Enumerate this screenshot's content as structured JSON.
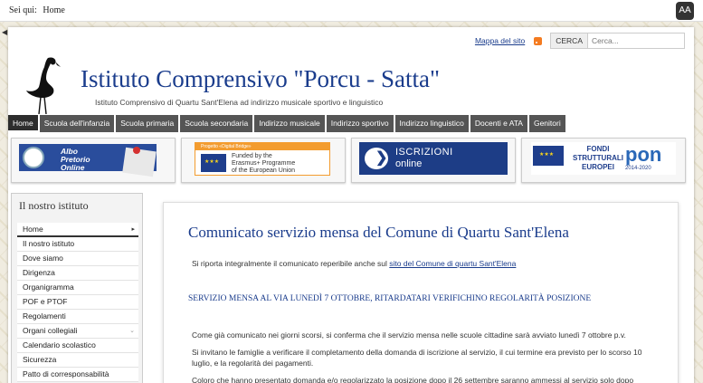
{
  "breadcrumb": {
    "label": "Sei qui:",
    "current": "Home"
  },
  "font_toggle": {
    "label": "AA"
  },
  "header": {
    "sitemap_link": "Mappa del sito",
    "search_label": "CERCA",
    "search_placeholder": "Cerca...",
    "title": "Istituto Comprensivo \"Porcu - Satta\"",
    "subtitle": "Istituto Comprensivo di Quartu Sant'Elena ad indirizzo musicale sportivo e linguistico"
  },
  "nav": {
    "items": [
      "Home",
      "Scuola dell'infanzia",
      "Scuola primaria",
      "Scuola secondaria",
      "Indirizzo musicale",
      "Indirizzo sportivo",
      "Indirizzo linguistico",
      "Docenti e ATA",
      "Genitori"
    ]
  },
  "banners": {
    "albo": {
      "line1": "Albo",
      "line2": "Pretorio",
      "line3": "Online"
    },
    "erasmus": {
      "top": "Progetto «Digital Bridge»",
      "line1": "Funded by the",
      "line2": "Erasmus+ Programme",
      "line3": "of the European Union"
    },
    "iscrizioni": {
      "line1": "ISCRIZIONI",
      "line2": "online"
    },
    "pon": {
      "line1": "FONDI",
      "line2": "STRUTTURALI",
      "line3": "EUROPEI",
      "logo": "pon",
      "years": "2014-2020"
    }
  },
  "sidebar": {
    "title": "Il nostro istituto",
    "items": [
      "Home",
      "Il nostro istituto",
      "Dove siamo",
      "Dirigenza",
      "Organigramma",
      "POF e PTOF",
      "Regolamenti",
      "Organi collegiali",
      "Calendario scolastico",
      "Sicurezza",
      "Patto di corresponsabilità"
    ]
  },
  "article": {
    "title": "Comunicato servizio mensa del Comune di Quartu Sant'Elena",
    "intro": "Si riporta integralmente il comunicato reperibile anche sul",
    "intro_link": "sito del Comune di quartu Sant'Elena",
    "subheading": "SERVIZIO MENSA AL VIA LUNEDÌ 7 OTTOBRE, RITARDATARI VERIFICHINO REGOLARITÀ POSIZIONE",
    "p1": "Come già comunicato nei giorni scorsi, si conferma che il servizio mensa nelle scuole cittadine sarà avviato lunedì 7 ottobre p.v.",
    "p2": "Si invitano le famiglie a verificare il completamento della domanda di iscrizione al servizio, il cui termine era previsto per lo scorso 10 luglio, e la regolarità dei pagamenti.",
    "p3": "Coloro che hanno presentato domanda e/o regolarizzato la posizione dopo il 26 settembre saranno ammessi al servizio solo dopo conferma dell'Assessorato alla Pubblica Istruzione. Per informazioni è possibile recarsi al Terzo piano del Palazzo Municipale o"
  }
}
